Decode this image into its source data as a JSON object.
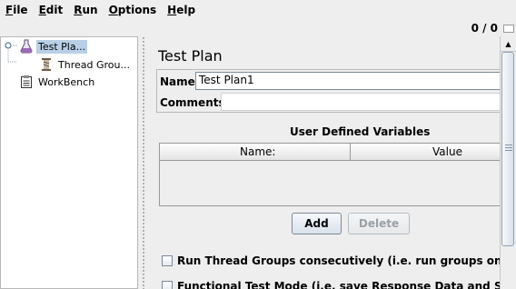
{
  "menu": {
    "items": [
      {
        "mnemonic": "F",
        "rest": "ile"
      },
      {
        "mnemonic": "E",
        "rest": "dit"
      },
      {
        "mnemonic": "R",
        "rest": "un"
      },
      {
        "mnemonic": "O",
        "rest": "ptions"
      },
      {
        "mnemonic": "H",
        "rest": "elp"
      }
    ]
  },
  "status": {
    "counter": "0 / 0"
  },
  "tree": {
    "items": [
      {
        "label": "Test Pla...",
        "icon": "flask-icon",
        "selected": true
      },
      {
        "label": "Thread Grou...",
        "icon": "spool-icon"
      },
      {
        "label": "WorkBench",
        "icon": "clipboard-icon"
      }
    ]
  },
  "content": {
    "title": "Test Plan",
    "name_label": "Name:",
    "name_value": "Test Plan1",
    "comments_label": "Comments:",
    "udv_title": "User Defined Variables",
    "table": {
      "col_name": "Name:",
      "col_value": "Value"
    },
    "buttons": {
      "add": "Add",
      "delete": "Delete"
    },
    "checkboxes": [
      {
        "label": "Run Thread Groups consecutively (i.e. run groups one at a time",
        "checked": false
      },
      {
        "label": "Functional Test Mode (i.e. save Response Data and Sampler Da",
        "checked": false
      }
    ]
  }
}
